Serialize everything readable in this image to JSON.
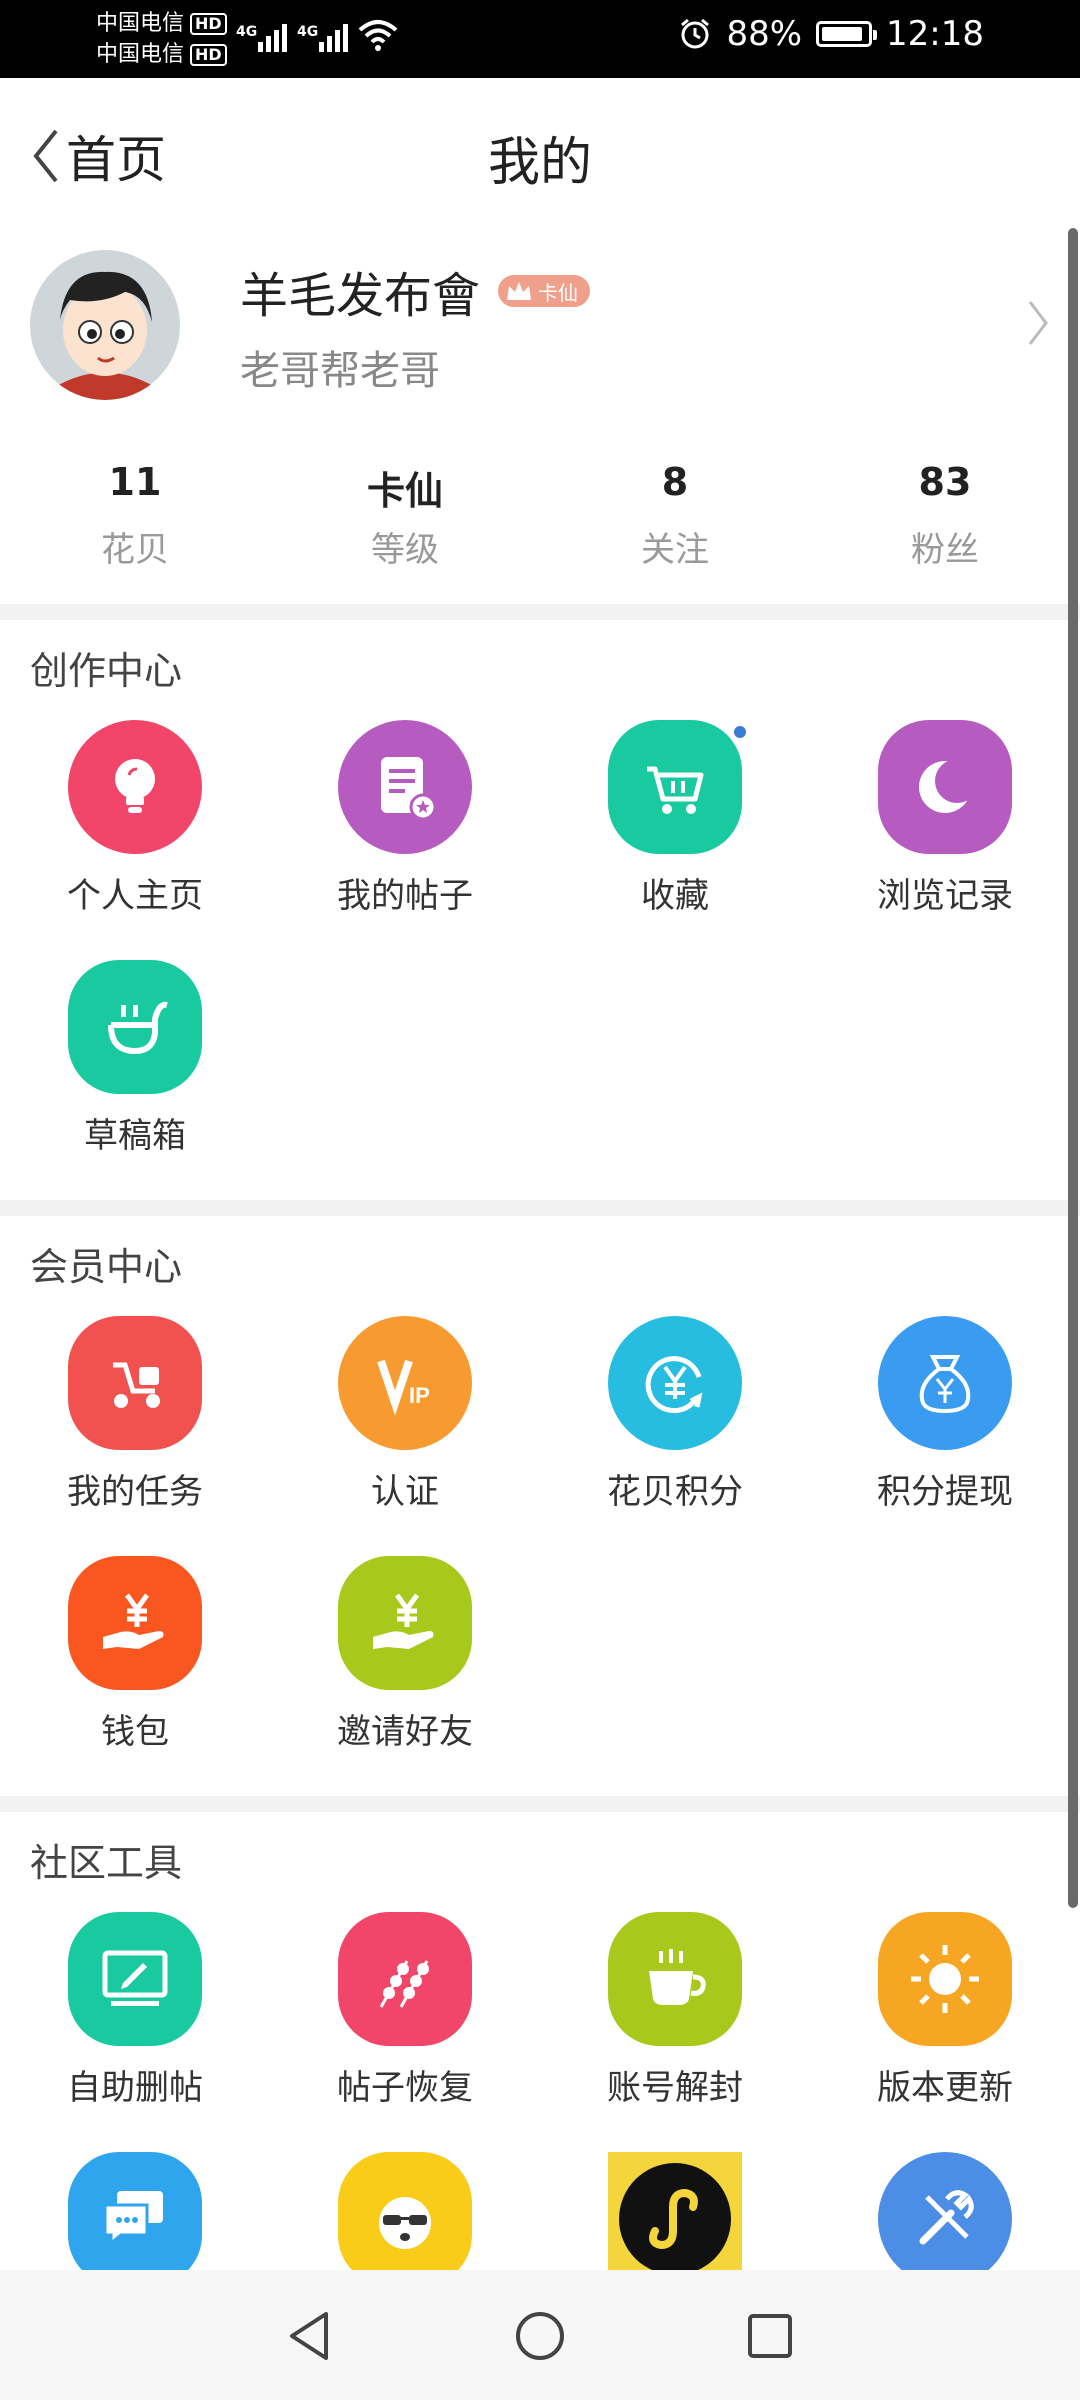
{
  "status_bar": {
    "carrier_1": "中国电信",
    "carrier_2": "中国电信",
    "hd": "HD",
    "network": "4G",
    "battery": "88%",
    "time": "12:18"
  },
  "header": {
    "back_label": "首页",
    "title": "我的"
  },
  "profile": {
    "name": "羊毛发布會",
    "badge": "卡仙",
    "subtitle": "老哥帮老哥"
  },
  "stats": [
    {
      "value": "11",
      "label": "花贝"
    },
    {
      "value": "卡仙",
      "label": "等级"
    },
    {
      "value": "8",
      "label": "关注"
    },
    {
      "value": "83",
      "label": "粉丝"
    }
  ],
  "sections": {
    "creation": {
      "title": "创作中心",
      "items": [
        {
          "label": "个人主页",
          "icon": "lightbulb-icon",
          "color": "#f2456a"
        },
        {
          "label": "我的帖子",
          "icon": "document-icon",
          "color": "#b65cc0"
        },
        {
          "label": "收藏",
          "icon": "cart-icon",
          "color": "#19c9a0"
        },
        {
          "label": "浏览记录",
          "icon": "moon-icon",
          "color": "#b65cc0"
        },
        {
          "label": "草稿箱",
          "icon": "smile-bag-icon",
          "color": "#19c9a0"
        }
      ]
    },
    "member": {
      "title": "会员中心",
      "items": [
        {
          "label": "我的任务",
          "icon": "scooter-icon",
          "color": "#f2524f"
        },
        {
          "label": "认证",
          "icon": "vip-icon",
          "color": "#f79a2f"
        },
        {
          "label": "花贝积分",
          "icon": "yuan-exchange-icon",
          "color": "#27bde1"
        },
        {
          "label": "积分提现",
          "icon": "money-bag-icon",
          "color": "#3a9cf1"
        },
        {
          "label": "钱包",
          "icon": "hand-yuan-icon",
          "color": "#f9571f"
        },
        {
          "label": "邀请好友",
          "icon": "hand-yuan-icon",
          "color": "#a8c81b"
        }
      ]
    },
    "tools": {
      "title": "社区工具",
      "items": [
        {
          "label": "自助删帖",
          "icon": "monitor-edit-icon",
          "color": "#19c9a0"
        },
        {
          "label": "帖子恢复",
          "icon": "skewer-icon",
          "color": "#f2456a"
        },
        {
          "label": "账号解封",
          "icon": "coffee-cup-icon",
          "color": "#a8c81b"
        },
        {
          "label": "版本更新",
          "icon": "sun-icon",
          "color": "#f7a623"
        },
        {
          "label": "",
          "icon": "chat-icon",
          "color": "#2fa5ee"
        },
        {
          "label": "",
          "icon": "sunglasses-face-icon",
          "color": "#f9cc1a"
        },
        {
          "label": "",
          "icon": "mini-program-icon",
          "color": "#f4d53b"
        },
        {
          "label": "",
          "icon": "tools-icon",
          "color": "#4c8de6"
        }
      ]
    }
  },
  "nav": {
    "back": "nav-back",
    "home": "nav-home",
    "recent": "nav-recent"
  }
}
